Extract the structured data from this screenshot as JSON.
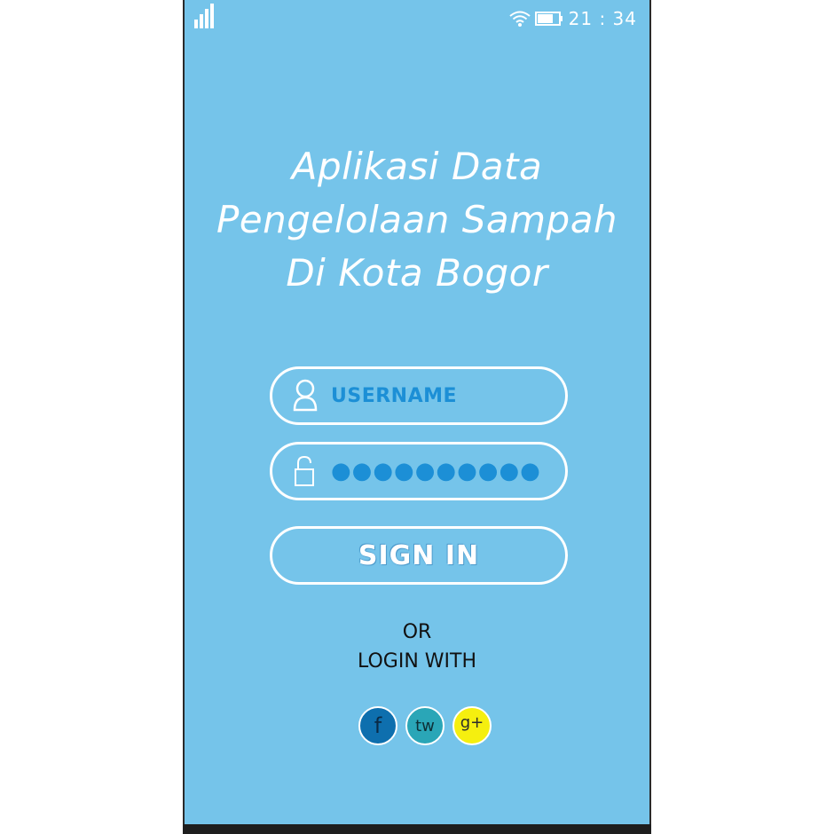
{
  "status_bar": {
    "signal_icon": "signal-bars-icon",
    "wifi_icon": "wifi-icon",
    "battery_icon": "battery-icon",
    "time": "21 : 34"
  },
  "title": {
    "line1": "Aplikasi Data",
    "line2": "Pengelolaan Sampah",
    "line3": "Di Kota Bogor"
  },
  "login_form": {
    "username_icon": "user-icon",
    "username_value": "USERNAME",
    "password_icon": "lock-icon",
    "password_value": "●●●●●●●●●●",
    "signin_label": "SIGN IN"
  },
  "alternative": {
    "or_text": "OR",
    "login_with_text": "LOGIN WITH",
    "social": [
      {
        "label": "f",
        "icon": "facebook-icon",
        "color": "#0e6fae"
      },
      {
        "label": "tw",
        "icon": "twitter-icon",
        "color": "#2aa6b7"
      },
      {
        "label": "g+",
        "icon": "google-plus-icon",
        "color": "#f5ef0f"
      }
    ]
  },
  "colors": {
    "background": "#75c4ea",
    "accent_text": "#1c8fd6",
    "border": "#ffffff"
  }
}
